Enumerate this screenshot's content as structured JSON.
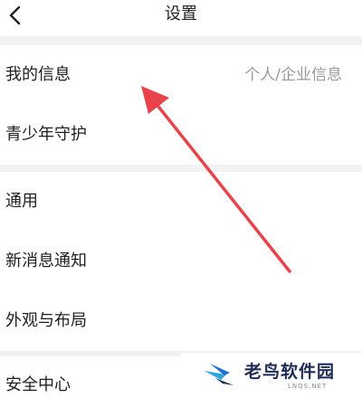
{
  "header": {
    "title": "设置",
    "back_icon": "chevron-left-icon"
  },
  "groups": [
    {
      "items": [
        {
          "label": "我的信息",
          "value": "个人/企业信息"
        },
        {
          "label": "青少年守护"
        }
      ]
    },
    {
      "items": [
        {
          "label": "通用"
        },
        {
          "label": "新消息通知"
        },
        {
          "label": "外观与布局"
        }
      ]
    },
    {
      "items": [
        {
          "label": "安全中心"
        }
      ]
    }
  ],
  "annotation": {
    "arrow_color": "#e8434a",
    "arrow_icon": "pointer-arrow-icon"
  },
  "watermark": {
    "brand": "老鸟软件园",
    "domain": "LNQS.NET",
    "logo_icon": "bird-logo-icon"
  }
}
